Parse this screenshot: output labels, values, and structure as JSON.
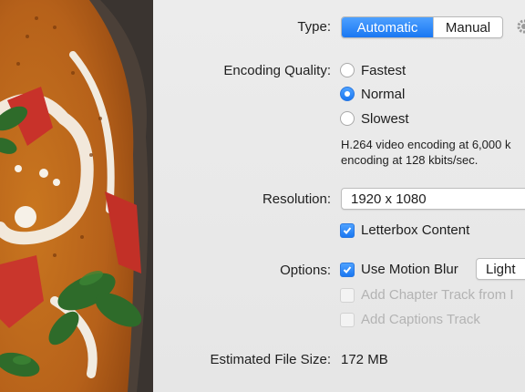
{
  "type": {
    "label": "Type:",
    "options": [
      "Automatic",
      "Manual"
    ],
    "selected": "Automatic"
  },
  "encoding_quality": {
    "label": "Encoding Quality:",
    "options": [
      "Fastest",
      "Normal",
      "Slowest"
    ],
    "selected": "Normal",
    "info_lines": [
      "H.264 video encoding at 6,000 k",
      "encoding at 128 kbits/sec."
    ]
  },
  "resolution": {
    "label": "Resolution:",
    "value": "1920 x 1080",
    "letterbox_label": "Letterbox Content",
    "letterbox_checked": true
  },
  "options": {
    "label": "Options:",
    "motion_blur_label": "Use Motion Blur",
    "motion_blur_checked": true,
    "motion_blur_level": "Light",
    "chapter_track_label": "Add Chapter Track from I",
    "captions_track_label": "Add Captions Track"
  },
  "file_size": {
    "label": "Estimated File Size:",
    "value": "172 MB"
  },
  "colors": {
    "accent": "#1a77f2",
    "panel_bg": "#e9e9e9",
    "disabled_text": "#b3b3b3"
  },
  "icons": [
    "gear-icon",
    "checkmark-icon",
    "food-photo"
  ]
}
